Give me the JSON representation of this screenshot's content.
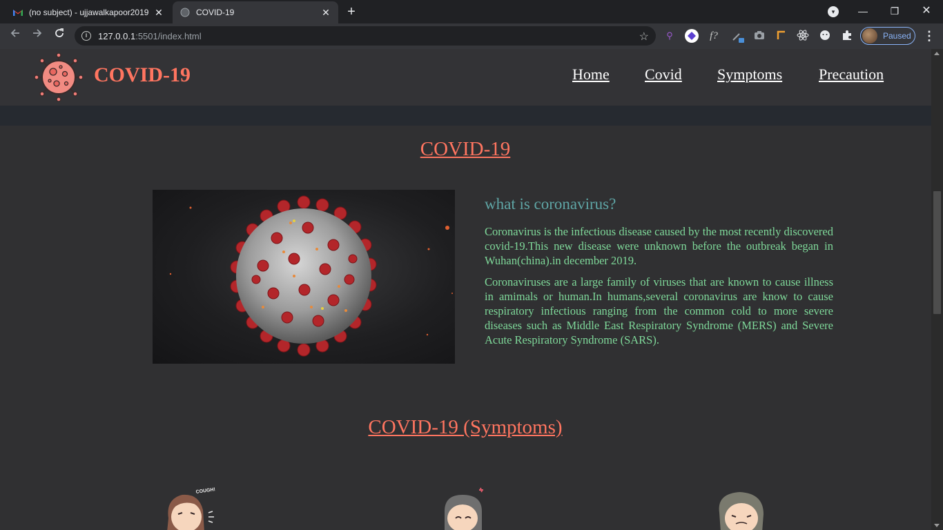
{
  "browser": {
    "tabs": [
      {
        "title": "(no subject) - ujjawalkapoor2019",
        "icon": "gmail-icon"
      },
      {
        "title": "COVID-19",
        "icon": "globe-icon",
        "active": true
      }
    ],
    "new_tab_label": "+",
    "url_host": "127.0.0.1",
    "url_rest": ":5501/index.html",
    "profile_status": "Paused",
    "extensions": [
      "search-extension-icon",
      "purple-diamond-extension-icon",
      "function-extension-icon",
      "eyedropper-extension-icon",
      "camera-extension-icon",
      "ruler-extension-icon",
      "react-devtools-icon",
      "face-extension-icon",
      "puzzle-extensions-icon"
    ]
  },
  "site": {
    "brand": "COVID-19",
    "nav": [
      "Home",
      "Covid",
      "Symptoms",
      "Precaution"
    ]
  },
  "covid_section": {
    "title": "COVID-19",
    "question": "what is coronavirus?",
    "paragraph1": "Coronavirus is the infectious disease caused by the most recently discovered covid-19.This new disease were unknown before the outbreak began in Wuhan(china).in december 2019.",
    "paragraph2": "Coronaviruses are a large family of viruses that are known to cause illness in amimals or human.In humans,several coronavirus are know to cause respiratory infectious ranging from the common cold to more severe diseases such as Middle East Respiratory Syndrome (MERS) and Severe Acute Respiratory Syndrome (SARS)."
  },
  "symptoms_section": {
    "title": "COVID-19 (Symptoms)",
    "cough_caption": "COUGH!"
  },
  "colors": {
    "accent": "#ff7560",
    "question": "#5fa6a6",
    "body_text": "#7fd99a",
    "background": "#303032"
  }
}
